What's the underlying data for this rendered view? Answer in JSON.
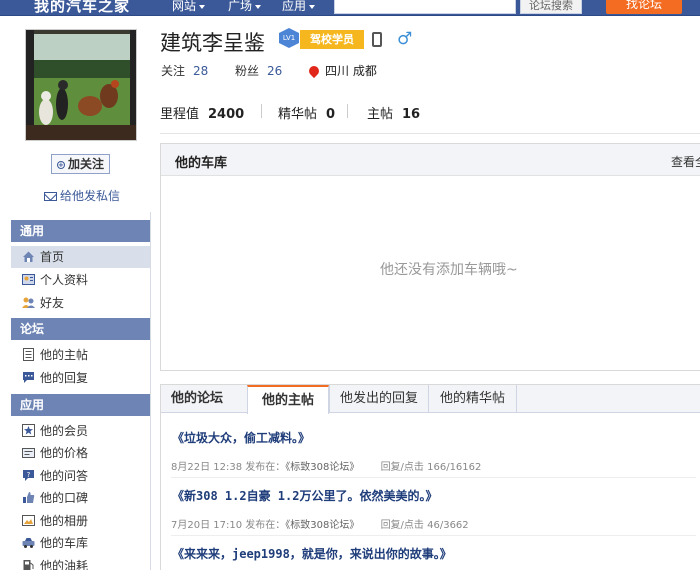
{
  "topbar": {
    "logo": "我的汽车之家",
    "nav": [
      "网站",
      "广场",
      "应用"
    ],
    "search_placeholder": "",
    "search_button": "论坛搜索",
    "find_forum_button": "找论坛"
  },
  "profile": {
    "username": "建筑李呈鉴",
    "level": "LV1",
    "role": "驾校学员",
    "following_label": "关注",
    "following_count": "28",
    "fans_label": "粉丝",
    "fans_count": "26",
    "location": "四川 成都",
    "mileage_label": "里程值",
    "mileage_value": "2400",
    "essence_label": "精华帖",
    "essence_value": "0",
    "posts_label": "主帖",
    "posts_value": "16",
    "follow_button": "加关注",
    "message_link": "给他发私信"
  },
  "sidebar": {
    "sections": [
      {
        "title": "通用",
        "items": [
          "首页",
          "个人资料",
          "好友"
        ]
      },
      {
        "title": "论坛",
        "items": [
          "他的主帖",
          "他的回复"
        ]
      },
      {
        "title": "应用",
        "items": [
          "他的会员",
          "他的价格",
          "他的问答",
          "他的口碑",
          "他的相册",
          "他的车库",
          "他的油耗"
        ]
      }
    ]
  },
  "garage": {
    "title": "他的车库",
    "more": "查看全",
    "empty_text": "他还没有添加车辆哦~"
  },
  "forum": {
    "label": "他的论坛",
    "tabs": [
      "他的主帖",
      "他发出的回复",
      "他的精华帖"
    ],
    "posts": [
      {
        "title": "《垃圾大众，偷工减料。》",
        "date": "8月22日 12:38",
        "posted_in": "发布在：",
        "board": "《标致308论坛》",
        "stats": "回复/点击 166/16162"
      },
      {
        "title": "《新308 1.2自豪 1.2万公里了。依然美美的。》",
        "date": "7月20日 17:10",
        "posted_in": "发布在：",
        "board": "《标致308论坛》",
        "stats": "回复/点击 46/3662"
      },
      {
        "title": "《来来来，jeep1998，就是你，来说出你的故事。》",
        "date": "",
        "posted_in": "",
        "board": "",
        "stats": ""
      }
    ]
  },
  "colors": {
    "brand_blue": "#3b5998",
    "accent_orange": "#f36c21",
    "badge_yellow": "#f5b71d",
    "sidebar_head": "#6d84b4"
  }
}
